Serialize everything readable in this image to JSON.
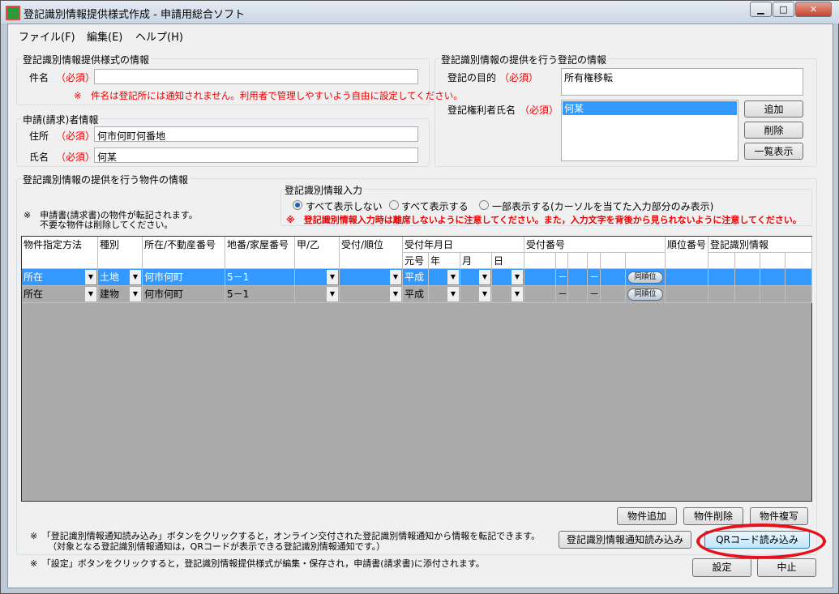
{
  "window": {
    "title": "登記識別情報提供様式作成 - 申請用総合ソフト",
    "minimize": "▁",
    "maximize": "□",
    "close": "✕"
  },
  "menu": [
    {
      "label": "ファイル(F)"
    },
    {
      "label": "編集(E)"
    },
    {
      "label": "ヘルプ(H)"
    }
  ],
  "form_info": {
    "legend": "登記識別情報提供様式の情報",
    "subject_label": "件名",
    "required": "（必須）",
    "subject_value": "",
    "subject_note": "※　件名は登記所には通知されません。利用者で管理しやすいよう自由に設定してください。"
  },
  "applicant": {
    "legend": "申請(請求)者情報",
    "address_label": "住所",
    "address_value": "何市何町何番地",
    "name_label": "氏名",
    "name_value": "何某",
    "required": "（必須）"
  },
  "registration": {
    "legend": "登記識別情報の提供を行う登記の情報",
    "purpose_label": "登記の目的",
    "purpose_value": "所有権移転",
    "holder_label": "登記権利者氏名",
    "required": "（必須）",
    "holders": [
      "何某"
    ],
    "add": "追加",
    "delete": "削除",
    "list": "一覧表示"
  },
  "property": {
    "legend": "登記識別情報の提供を行う物件の情報",
    "note1": "※　申請書(請求書)の物件が転記されます。",
    "note2": "不要な物件は削除してください。"
  },
  "id_input": {
    "legend": "登記識別情報入力",
    "options": [
      {
        "label": "すべて表示しない",
        "selected": true
      },
      {
        "label": "すべて表示する",
        "selected": false
      },
      {
        "label": "一部表示する(カーソルを当てた入力部分のみ表示)",
        "selected": false
      }
    ],
    "warning": "※　登記識別情報入力時は離席しないように注意してください。また，入力文字を背後から見られないように注意してください。"
  },
  "table": {
    "headers": [
      "物件指定方法",
      "種別",
      "所在/不動産番号",
      "地番/家屋番号",
      "甲/乙",
      "受付/順位",
      "受付年月日",
      "受付番号",
      "順位番号",
      "登記識別情報"
    ],
    "date_sub": [
      "元号",
      "年",
      "月",
      "日"
    ],
    "rows": [
      {
        "method": "所在",
        "type": "土地",
        "location": "何市何町",
        "number": "5－1",
        "era": "平成",
        "dash": "－",
        "button": "同順位",
        "selected": true
      },
      {
        "method": "所在",
        "type": "建物",
        "location": "何市何町",
        "number": "5－1",
        "era": "平成",
        "dash": "－",
        "button": "同順位",
        "selected": false
      }
    ]
  },
  "buttons": {
    "add_property": "物件追加",
    "delete_property": "物件削除",
    "copy_property": "物件複写",
    "read_notice": "登記識別情報通知読み込み",
    "read_qr": "QRコード読み込み",
    "settings": "設定",
    "cancel": "中止"
  },
  "notes": {
    "read1": "※　「登記識別情報通知読み込み」ボタンをクリックすると，オンライン交付された登記識別情報通知から情報を転記できます。",
    "read2": "（対象となる登記識別情報通知は，QRコードが表示できる登記識別情報通知です。）",
    "settings": "※　「設定」ボタンをクリックすると，登記識別情報提供様式が編集・保存され，申請書(請求書)に添付されます。"
  },
  "colors": {
    "required": "#ee0000",
    "selection": "#3399ff",
    "highlight_circle": "#e8101a"
  }
}
